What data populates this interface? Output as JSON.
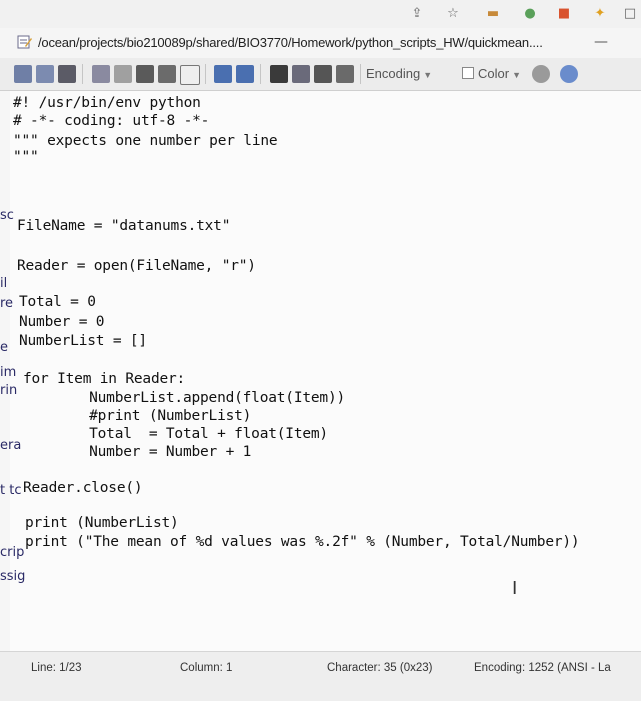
{
  "window": {
    "title": "/ocean/projects/bio210089p/shared/BIO3770/Homework/python_scripts_HW/quickmean...."
  },
  "toolbar": {
    "encoding_label": "Encoding",
    "color_label": "Color"
  },
  "code_lines": [
    "#! /usr/bin/env python",
    "# -*- coding: utf-8 -*-",
    "\"\"\" expects one number per line",
    "\"\"\"",
    "FileName = \"datanums.txt\"",
    "Reader = open(FileName, \"r\")",
    "Total = 0",
    "Number = 0",
    "NumberList = []",
    "for Item in Reader:",
    "    NumberList.append(float(Item))",
    "    #print (NumberList)",
    "    Total  = Total + float(Item)",
    "    Number = Number + 1",
    "Reader.close()",
    "print (NumberList)",
    "print (\"The mean of %d values was %.2f\" % (Number, Total/Number))"
  ],
  "background_fragments": [
    "sc",
    "il",
    "re",
    "e",
    "im",
    "rin",
    "era",
    "t tc",
    "crip",
    "ssig"
  ],
  "status": {
    "line": "Line: 1/23",
    "column": "Column: 1",
    "character": "Character: 35 (0x23)",
    "encoding": "Encoding: 1252  (ANSI - La"
  }
}
